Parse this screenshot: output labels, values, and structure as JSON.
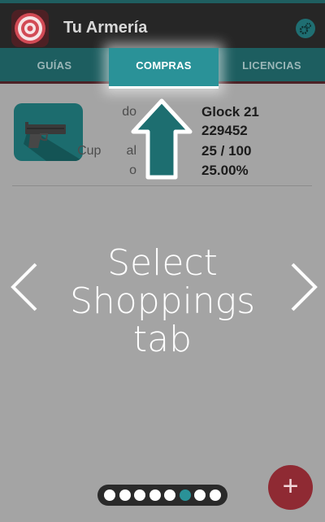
{
  "app": {
    "title": "Tu Armería"
  },
  "tabs": [
    {
      "label": "GUÍAS"
    },
    {
      "label": "COMPRAS"
    },
    {
      "label": "LICENCIAS"
    }
  ],
  "item": {
    "fields": [
      {
        "label": "do",
        "value": "Glock 21"
      },
      {
        "label": "",
        "value": "229452"
      },
      {
        "label": "Cup       al",
        "value": "25 / 100"
      },
      {
        "label": "o",
        "value": "25.00%"
      }
    ]
  },
  "tutorial": {
    "text_lines": [
      "Select",
      "Shoppings",
      "tab"
    ],
    "total_pages": 8,
    "current_page": 6
  },
  "fab": {
    "icon": "plus-icon",
    "label": "+"
  },
  "colors": {
    "teal": "#1d5e60",
    "active_tab": "#2a9298",
    "fab": "#8f2a33",
    "appbar": "#262626"
  }
}
